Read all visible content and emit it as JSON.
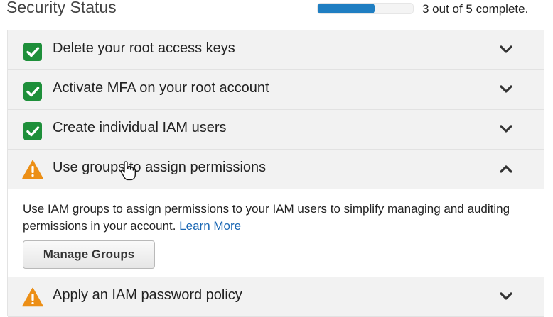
{
  "header": {
    "title": "Security Status",
    "progress_text": "3 out of 5 complete.",
    "progress_fraction": 0.6
  },
  "colors": {
    "check_green": "#1e8f3a",
    "warning_orange": "#ec8f16",
    "progress_blue": "#1f7ec2",
    "link_blue": "#1a67b4"
  },
  "items": [
    {
      "label": "Delete your root access keys",
      "status": "complete",
      "icon": "green-check-icon",
      "chevron": "chevron-down-icon"
    },
    {
      "label": "Activate MFA on your root account",
      "status": "complete",
      "icon": "green-check-icon",
      "chevron": "chevron-down-icon"
    },
    {
      "label": "Create individual IAM users",
      "status": "complete",
      "icon": "green-check-icon",
      "chevron": "chevron-down-icon"
    },
    {
      "label": "Use groups to assign permissions",
      "status": "warning",
      "icon": "warning-icon",
      "chevron": "chevron-up-icon",
      "expanded": true
    },
    {
      "label": "Apply an IAM password policy",
      "status": "warning",
      "icon": "warning-icon",
      "chevron": "chevron-down-icon"
    }
  ],
  "expanded_details": {
    "description": "Use IAM groups to assign permissions to your IAM users to simplify managing and auditing permissions in your account.",
    "learn_more": "Learn More",
    "button_label": "Manage Groups"
  }
}
